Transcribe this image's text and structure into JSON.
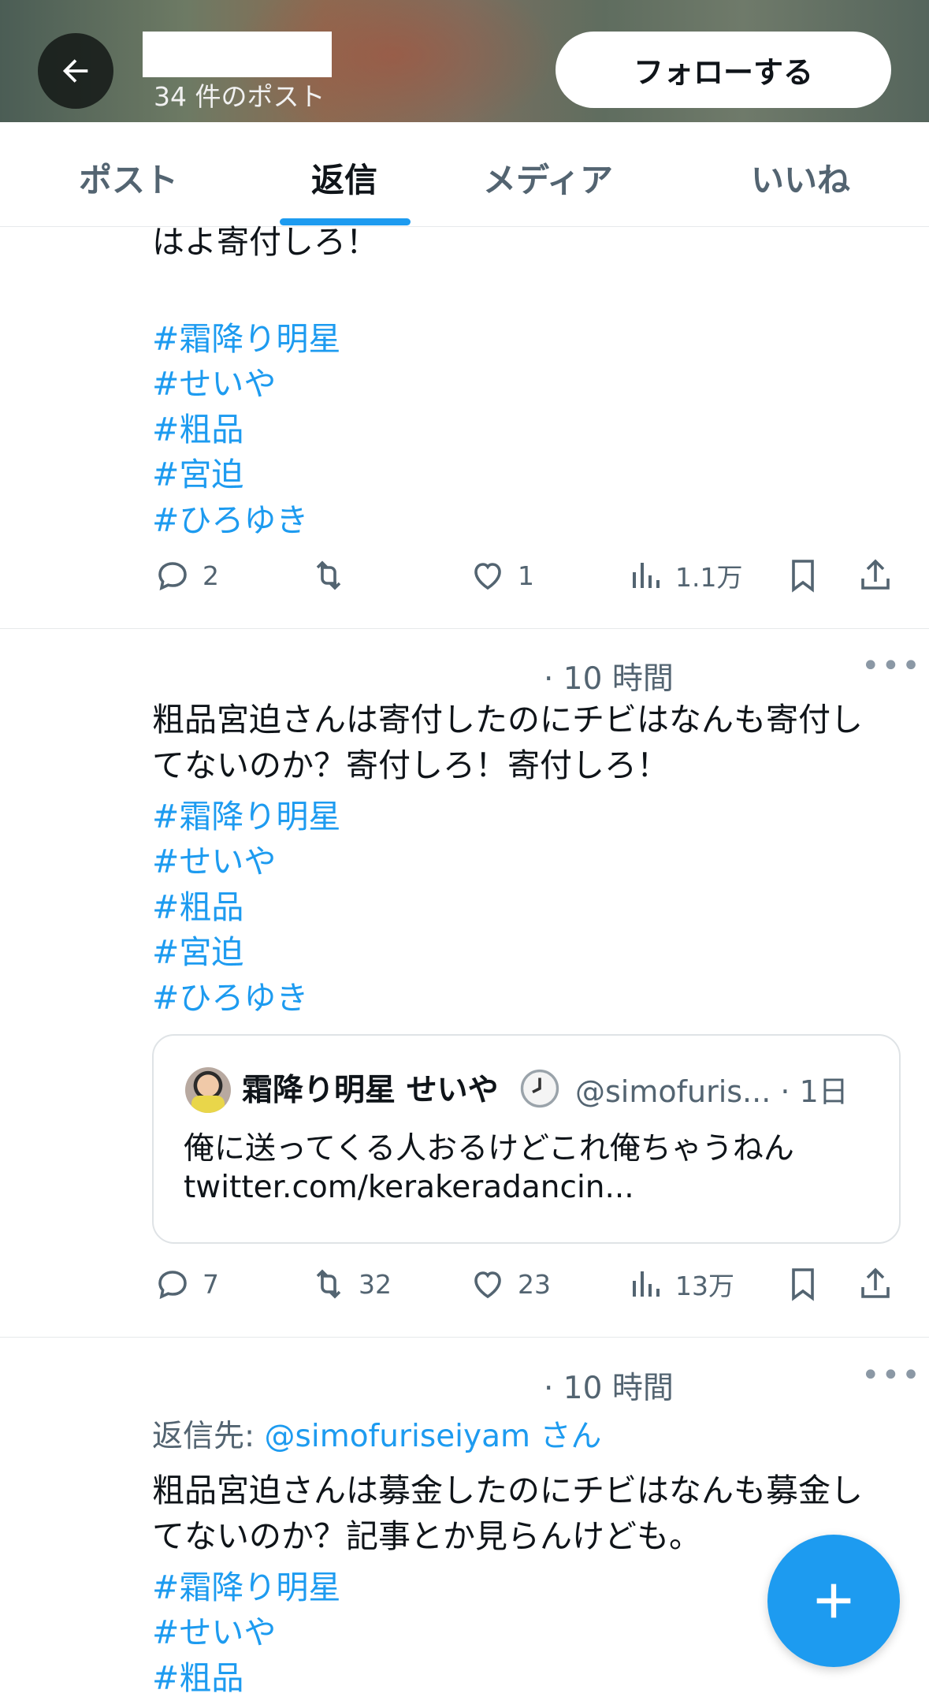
{
  "header": {
    "post_count": "34 件のポスト",
    "follow_label": "フォローする"
  },
  "tabs": [
    {
      "label": "ポスト"
    },
    {
      "label": "返信",
      "active": true
    },
    {
      "label": "メディア"
    },
    {
      "label": "いいね"
    }
  ],
  "post1": {
    "text_tail": "はよ寄付しろ！",
    "hashtags": [
      "#霜降り明星",
      "#せいや",
      "#粗品",
      "#宮迫",
      "#ひろゆき"
    ],
    "replies": "2",
    "reposts": "",
    "likes": "1",
    "views": "1.1万"
  },
  "post2": {
    "time": "· 10 時間",
    "text_lines": [
      "粗品宮迫さんは寄付したのにチビはなんも寄付し",
      "てないのか？寄付しろ！寄付しろ！"
    ],
    "hashtags": [
      "#霜降り明星",
      "#せいや",
      "#粗品",
      "#宮迫",
      "#ひろゆき"
    ],
    "quote": {
      "name": "霜降り明星 せいや",
      "handle": "@simofuris...",
      "time": "· 1日",
      "text_lines": [
        "俺に送ってくる人おるけどこれ俺ちゃうねん",
        "twitter.com/kerakeradancin..."
      ]
    },
    "replies": "7",
    "reposts": "32",
    "likes": "23",
    "views": "13万"
  },
  "post3": {
    "time": "· 10 時間",
    "reply_to_prefix": "返信先: ",
    "reply_to_handle": "@simofuriseiyam",
    "reply_to_suffix": " さん",
    "text_lines": [
      "粗品宮迫さんは募金したのにチビはなんも募金し",
      "てないのか？記事とか見らんけども。"
    ],
    "hashtags": [
      "#霜降り明星",
      "#せいや",
      "#粗品"
    ]
  },
  "colors": {
    "accent": "#1d9bf0",
    "text": "#0f1419",
    "secondary": "#536471"
  }
}
